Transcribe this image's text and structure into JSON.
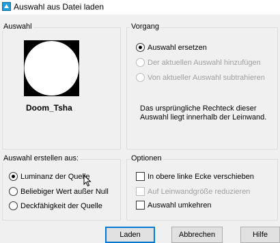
{
  "window": {
    "title": "Auswahl aus Datei laden",
    "icon": "app-icon"
  },
  "auswahl_group": {
    "legend": "Auswahl",
    "preview_name": "Doom_Tsha"
  },
  "vorgang_group": {
    "legend": "Vorgang",
    "options": [
      {
        "label": "Auswahl ersetzen",
        "selected": true,
        "enabled": true
      },
      {
        "label": "Der aktuellen Auswahl hinzufügen",
        "selected": false,
        "enabled": false
      },
      {
        "label": "Von aktueller Auswahl subtrahieren",
        "selected": false,
        "enabled": false
      }
    ],
    "info": "Das ursprüngliche Rechteck dieser Auswahl liegt innerhalb der Leinwand."
  },
  "erstellen_group": {
    "legend": "Auswahl erstellen aus:",
    "options": [
      {
        "label": "Luminanz der Quelle",
        "selected": true
      },
      {
        "label": "Beliebiger Wert außer Null",
        "selected": false
      },
      {
        "label": "Deckfähigkeit der Quelle",
        "selected": false
      }
    ]
  },
  "optionen_group": {
    "legend": "Optionen",
    "options": [
      {
        "label": "In obere linke Ecke verschieben",
        "checked": false,
        "enabled": true
      },
      {
        "label": "Auf Leinwandgröße reduzieren",
        "checked": false,
        "enabled": false
      },
      {
        "label": "Auswahl umkehren",
        "checked": false,
        "enabled": true
      }
    ]
  },
  "buttons": {
    "load": "Laden",
    "cancel": "Abbrechen",
    "help": "Hilfe"
  },
  "colors": {
    "accent": "#0078d7",
    "preview_bg": "#000000",
    "preview_shape": "#ffffff"
  }
}
